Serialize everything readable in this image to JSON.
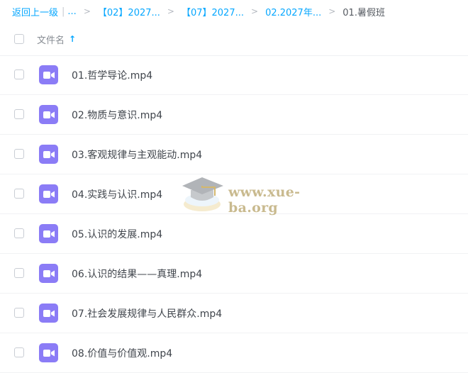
{
  "breadcrumb": {
    "back_label": "返回上一级",
    "separator_bar": "|",
    "ellipsis": "...",
    "separator": ">",
    "items": [
      "【02】2027...",
      "【07】2027...",
      "02.2027年..."
    ],
    "current": "01.暑假班"
  },
  "table_header": {
    "name_label": "文件名",
    "sort_icon": "arrow-up-icon"
  },
  "files": [
    {
      "name": "01.哲学导论.mp4",
      "icon": "video-file-icon"
    },
    {
      "name": "02.物质与意识.mp4",
      "icon": "video-file-icon"
    },
    {
      "name": "03.客观规律与主观能动.mp4",
      "icon": "video-file-icon"
    },
    {
      "name": "04.实践与认识.mp4",
      "icon": "video-file-icon"
    },
    {
      "name": "05.认识的发展.mp4",
      "icon": "video-file-icon"
    },
    {
      "name": "06.认识的结果——真理.mp4",
      "icon": "video-file-icon"
    },
    {
      "name": "07.社会发展规律与人民群众.mp4",
      "icon": "video-file-icon"
    },
    {
      "name": "08.价值与价值观.mp4",
      "icon": "video-file-icon"
    }
  ],
  "watermark": {
    "text": "www.xue-ba.org"
  },
  "colors": {
    "accent": "#06a7ff",
    "video_icon": "#8b7cf6"
  }
}
